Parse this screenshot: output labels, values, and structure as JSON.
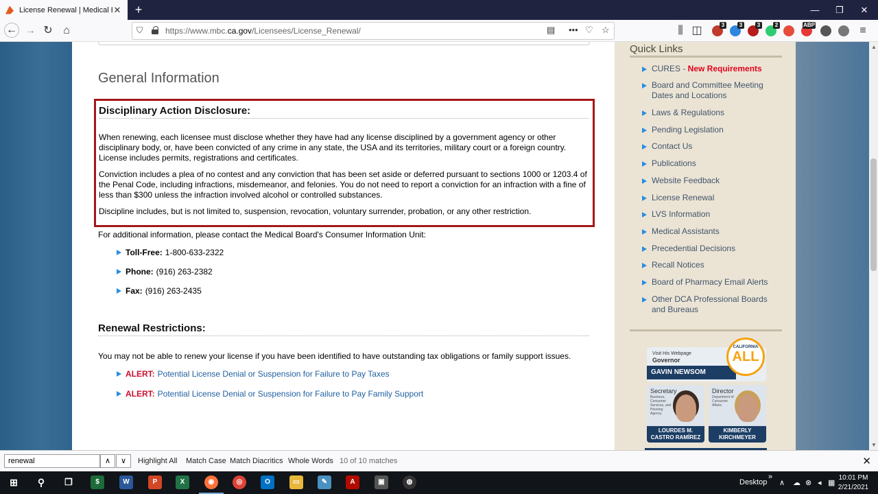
{
  "browser": {
    "tab_title": "License Renewal | Medical Boa",
    "url_prefix": "https://www.mbc.",
    "url_domain": "ca.gov",
    "url_path": "/Licensees/License_Renewal/",
    "extensions": [
      {
        "name": "ublock-icon",
        "badge": "3",
        "color": "#c0392b"
      },
      {
        "name": "extension-blue-icon",
        "badge": "3",
        "color": "#2e86de"
      },
      {
        "name": "extension-red-icon",
        "badge": "3",
        "color": "#b71c1c"
      },
      {
        "name": "ghostery-icon",
        "badge": "2",
        "color": "#2ecc71"
      },
      {
        "name": "extension-lines-icon",
        "badge": "",
        "color": "#e74c3c"
      },
      {
        "name": "adblock-plus-icon",
        "badge": "ABP",
        "color": "#e53935"
      },
      {
        "name": "extension-w-icon",
        "badge": "",
        "color": "#555"
      },
      {
        "name": "extension-gray-icon",
        "badge": "",
        "color": "#777"
      }
    ]
  },
  "main": {
    "section_title": "General Information",
    "disclosure": {
      "heading": "Disciplinary Action Disclosure:",
      "p1": "When renewing, each licensee must disclose whether they have had any license disciplined by a government agency or other disciplinary body, or, have been convicted of any crime in any state, the USA and its territories, military court or a foreign country. License includes permits, registrations and certificates.",
      "p2": "Conviction includes a plea of no contest and any conviction that has been set aside or deferred pursuant to sections 1000 or 1203.4 of the Penal Code, including infractions, misdemeanor, and felonies. You do not need to report a conviction for an infraction with a fine of less than $300 unless the infraction involved alcohol or controlled substances.",
      "p3": "Discipline includes, but is not limited to, suspension, revocation, voluntary surrender, probation, or any other restriction."
    },
    "contact_intro": "For additional information, please contact the Medical Board's Consumer Information Unit:",
    "contacts": [
      {
        "label": "Toll-Free:",
        "value": "1-800-633-2322"
      },
      {
        "label": "Phone:",
        "value": "(916) 263-2382"
      },
      {
        "label": "Fax:",
        "value": "(916) 263-2435"
      }
    ],
    "renewal": {
      "heading": "Renewal Restrictions:",
      "text": "You may not be able to renew your license if you have been identified to have outstanding tax obligations or family support issues.",
      "alert_label": "ALERT:",
      "alerts": [
        "Potential License Denial or Suspension for Failure to Pay Taxes",
        "Potential License Denial or Suspension for Failure to Pay Family Support"
      ]
    }
  },
  "sidebar": {
    "title": "Quick Links",
    "cures_prefix": "CURES - ",
    "cures_new": "New Requirements",
    "links": [
      "Board and Committee Meeting Dates and Locations",
      "Laws & Regulations",
      "Pending Legislation",
      "Contact Us",
      "Publications",
      "Website Feedback",
      "License Renewal",
      "LVS Information",
      "Medical Assistants",
      "Precedential Decisions",
      "Recall Notices",
      "Board of Pharmacy Email Alerts",
      "Other DCA Professional Boards and Bureaus"
    ],
    "governor": {
      "visit": "Visit His Webpage",
      "title": "Governor",
      "name": "GAVIN NEWSOM",
      "badge_top": "CALIFORNIA",
      "badge_main": "ALL"
    },
    "secretary": {
      "role": "Secretary",
      "sub": "Business, Consumer Services, and Housing Agency",
      "name": "LOURDES M. CASTRO RAMÍREZ"
    },
    "director": {
      "role": "Director",
      "sub": "Department of Consumer Affairs",
      "name": "KIMBERLY KIRCHMEYER"
    }
  },
  "findbar": {
    "query": "renewal",
    "highlight_all": "Highlight All",
    "match_case": "Match Case",
    "match_diacritics": "Match Diacritics",
    "whole_words": "Whole Words",
    "count": "10 of 10 matches"
  },
  "taskbar": {
    "desktop_label": "Desktop",
    "time": "10:01 PM",
    "date": "2/21/2021"
  }
}
